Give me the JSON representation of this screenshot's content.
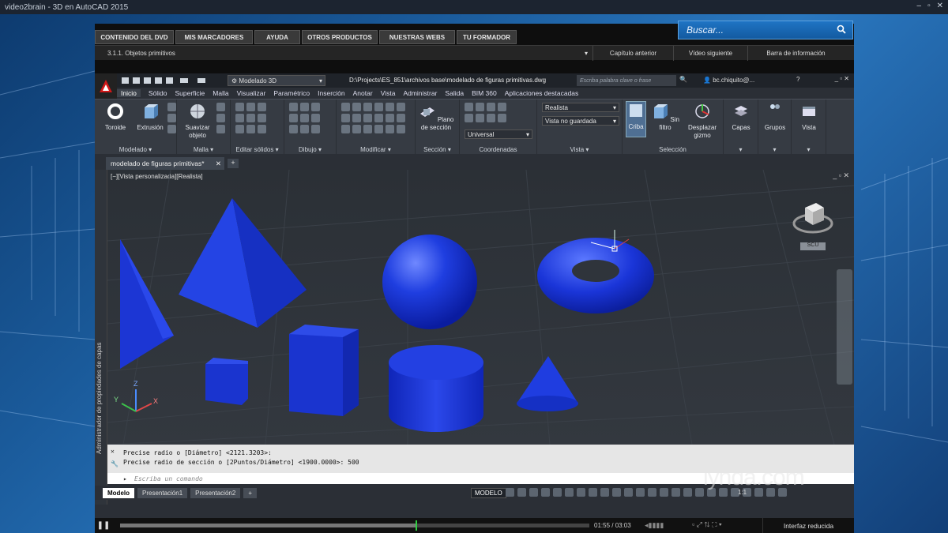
{
  "window": {
    "title": "video2brain - 3D en AutoCAD 2015",
    "controls": [
      "–",
      "▫",
      "✕"
    ]
  },
  "player": {
    "top_tabs": [
      "CONTENIDO DEL DVD",
      "MIS MARCADORES",
      "AYUDA",
      "OTROS PRODUCTOS",
      "NUESTRAS WEBS",
      "TU FORMADOR"
    ],
    "search_placeholder": "Buscar...",
    "lesson": "3.1.1. Objetos primitivos",
    "nav": [
      "Capítulo anterior",
      "Vídeo siguiente",
      "Barra de información"
    ],
    "time": "01:55 / 03:03",
    "progress": 0.63,
    "reduced_interface": "Interfaz reducida"
  },
  "autocad": {
    "workspace": "Modelado 3D",
    "filepath": "D:\\Projects\\ES_851\\archivos base\\modelado de figuras primitivas.dwg",
    "keyword_search": "Escriba palabra clave o frase",
    "user": "bc.chiquito@...",
    "ribbon_tabs": [
      "Inicio",
      "Sólido",
      "Superficie",
      "Malla",
      "Visualizar",
      "Paramétrico",
      "Inserción",
      "Anotar",
      "Vista",
      "Administrar",
      "Salida",
      "BIM 360",
      "Aplicaciones destacadas"
    ],
    "panels": {
      "modelado": {
        "title": "Modelado",
        "buttons": [
          "Toroide",
          "Extrusión"
        ]
      },
      "malla": {
        "title": "Malla",
        "buttons": [
          "Suavizar objeto"
        ]
      },
      "editar": {
        "title": "Editar sólidos"
      },
      "dibujo": {
        "title": "Dibujo"
      },
      "modificar": {
        "title": "Modificar"
      },
      "seccion": {
        "title": "Sección",
        "buttons": [
          "Plano de sección"
        ]
      },
      "coordenadas": {
        "title": "Coordenadas",
        "ucs": "Universal"
      },
      "vista": {
        "title": "Vista",
        "visual_style": "Realista",
        "view_state": "Vista no guardada"
      },
      "seleccion": {
        "title": "Selección",
        "buttons": [
          "Criba",
          "Sin filtro",
          "Desplazar gizmo"
        ]
      },
      "capas": {
        "buttons": [
          "Capas",
          "Grupos",
          "Vista"
        ]
      }
    },
    "document_tab": "modelado de figuras primitivas*",
    "viewport_label": "[−][Vista personalizada][Realista]",
    "side_palette": "Administrador de propiedades de capas",
    "viewcube_label": "SCU",
    "axes": {
      "x": "X",
      "y": "Y",
      "z": "Z"
    },
    "command_history": [
      "Precise radio o [Diámetro] <2121.3203>:",
      "Precise radio de sección o [2Puntos/Diámetro] <1900.0000>: 500"
    ],
    "command_placeholder": "Escriba un comando",
    "layout_tabs": [
      "Modelo",
      "Presentación1",
      "Presentación2"
    ],
    "status_mode": "MODELO",
    "scale": "1:1"
  },
  "watermark": "lynda.com",
  "colors": {
    "solid": "#1a35d8",
    "accent": "#1f74c4"
  }
}
